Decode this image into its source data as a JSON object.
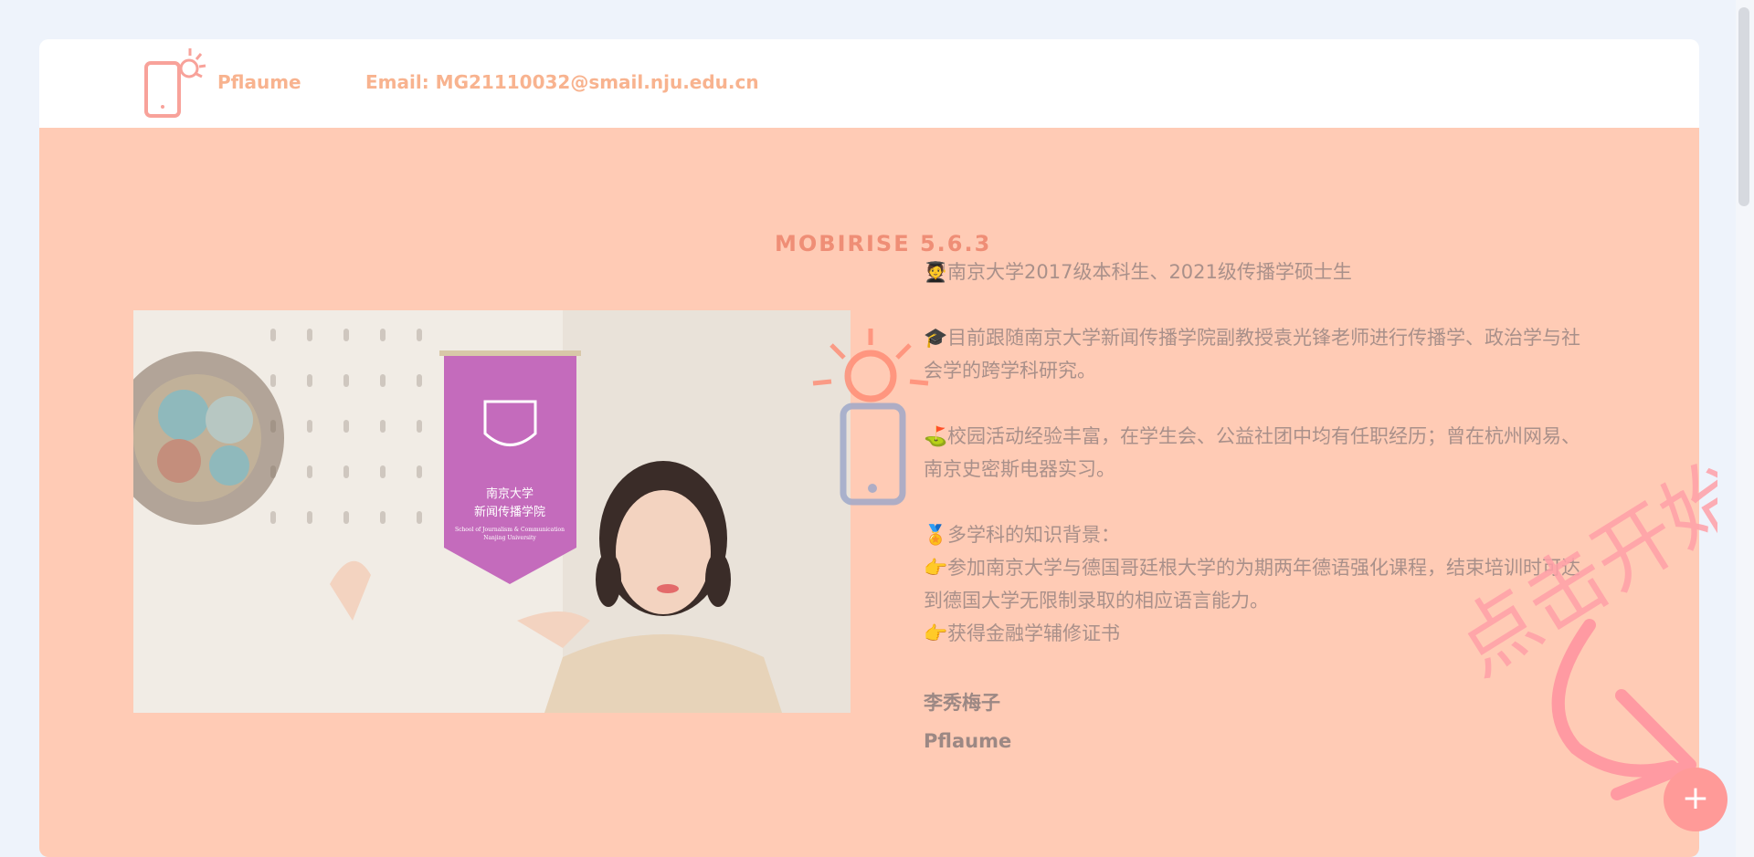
{
  "header": {
    "brand": "Pflaume",
    "email": "Email: MG21110032@smail.nju.edu.cn",
    "logo_icon": "phone-sun-icon"
  },
  "overlay": {
    "badge": "MOBIRISE 5.6.3",
    "handwriting": "点击开始",
    "watermark_icon": "phone-sun-icon"
  },
  "photo": {
    "pennant_title": "南京大学",
    "pennant_subtitle": "新闻传播学院",
    "pennant_en_1": "School of Journalism & Communication",
    "pennant_en_2": "Nanjing University"
  },
  "content": {
    "line1_icon": "student-emoji",
    "line1": "南京大学2017级本科生、2021级传播学硕士生",
    "line2_icon": "graduation-cap-emoji",
    "line2": "目前跟随南京大学新闻传播学院副教授袁光锋老师进行传播学、政治学与社会学的跨学科研究。",
    "line3_icon": "golf-flag-emoji",
    "line3": "校园活动经验丰富，在学生会、公益社团中均有任职经历；曾在杭州网易、南京史密斯电器实习。",
    "line4_icon": "medal-emoji",
    "line4": "多学科的知识背景：",
    "line5_icon": "pointing-hand-emoji",
    "line5": "参加南京大学与德国哥廷根大学的为期两年德语强化课程，结束培训时可达到德国大学无限制录取的相应语言能力。",
    "line6_icon": "pointing-hand-emoji",
    "line6": "获得金融学辅修证书",
    "signature_cn": "李秀梅子",
    "signature_en": "Pflaume"
  },
  "fab": {
    "label": "+"
  },
  "colors": {
    "accent": "#ffcbb5",
    "brand": "#f8b38f",
    "fab": "#ff9a98"
  }
}
